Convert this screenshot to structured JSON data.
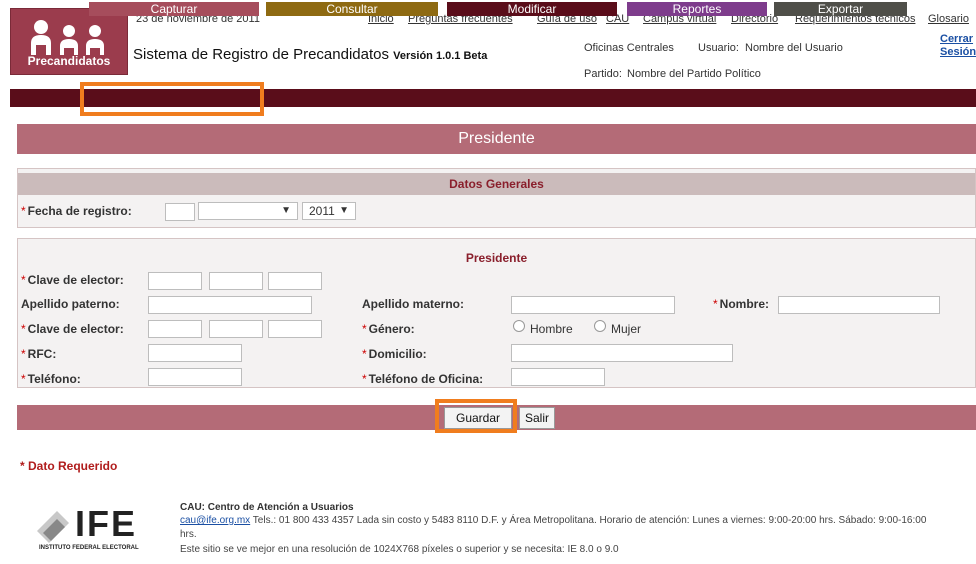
{
  "header": {
    "date": "23 de noviembre de 2011",
    "system_title": "Sistema de Registro de Precandidatos",
    "version": "Versión 1.0.1 Beta",
    "logo_text": "Precandidatos",
    "links": {
      "inicio": "Inicio",
      "preguntas": "Preguntas frecuentes",
      "guia": "Guía de uso",
      "cau": "CAU",
      "campus": "Campus virtual",
      "directorio": "Directorio",
      "requerimientos": "Requerimientos técnicos",
      "glosario": "Glosario"
    },
    "office": "Oficinas Centrales",
    "usuario_label": "Usuario:",
    "usuario_value": "Nombre del Usuario",
    "partido_label": "Partido:",
    "partido_value": "Nombre del Partido Político",
    "cerrar": "Cerrar",
    "sesion": "Sesión"
  },
  "menu": {
    "capturar": "Capturar",
    "consultar": "Consultar",
    "modificar": "Modificar",
    "reportes": "Reportes",
    "exportar": "Exportar",
    "colors": {
      "capturar": "#a64d5c",
      "consultar": "#8e6a12",
      "modificar": "#5a0d1a",
      "reportes": "#7e3c8c",
      "exportar": "#4f4f49",
      "highlight": "#f07d1e"
    }
  },
  "page_title": "Presidente",
  "datos_generales": {
    "title": "Datos Generales",
    "fecha_label": "Fecha de registro:",
    "year": "2011",
    "month": ""
  },
  "presidente": {
    "title": "Presidente",
    "clave_elector": "Clave de elector:",
    "apellido_paterno": "Apellido paterno:",
    "apellido_materno": "Apellido materno:",
    "nombre": "Nombre:",
    "clave_elector_2": "Clave de elector:",
    "genero": "Género:",
    "hombre": "Hombre",
    "mujer": "Mujer",
    "rfc": "RFC:",
    "domicilio": "Domicilio:",
    "telefono": "Teléfono:",
    "telefono_oficina": "Teléfono de Oficina:"
  },
  "buttons": {
    "guardar": "Guardar",
    "salir": "Salir"
  },
  "dato_requerido": "* Dato Requerido",
  "footer": {
    "logo_text": "IFE",
    "logo_subtext": "INSTITUTO FEDERAL ELECTORAL",
    "cau_title": "CAU: Centro de Atención a Usuarios",
    "email": "cau@ife.org.mx",
    "line1": "Tels.: 01 800 433 4357 Lada sin costo y 5483 8110 D.F. y Área Metropolitana. Horario de atención: Lunes a viernes: 9:00-20:00 hrs. Sábado: 9:00-16:00",
    "line2": "hrs.",
    "line3": "Este sitio se ve mejor en una resolución de 1024X768 píxeles o superior y se necesita: IE 8.0 o 9.0"
  }
}
